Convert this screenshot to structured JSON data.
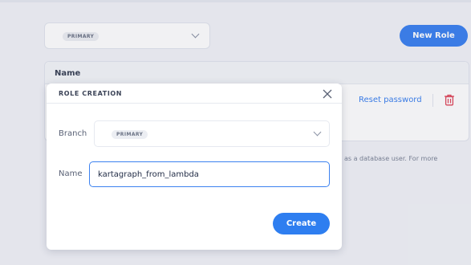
{
  "background": {
    "branch_select": {
      "selected": "PRIMARY"
    },
    "new_role_button": "New Role",
    "table": {
      "header": "Name"
    },
    "row_actions": {
      "reset_password": "Reset password"
    },
    "footnote_right": "as a database user. For more"
  },
  "modal": {
    "title": "ROLE CREATION",
    "branch_label": "Branch",
    "branch_value": "PRIMARY",
    "name_label": "Name",
    "name_value": "kartagraph_from_lambda",
    "create_button": "Create"
  },
  "colors": {
    "accent": "#3c82f0",
    "danger": "#e0465a",
    "background": "#f1f3f8"
  },
  "icons": [
    "chevron-down-icon",
    "close-icon",
    "trash-icon"
  ]
}
